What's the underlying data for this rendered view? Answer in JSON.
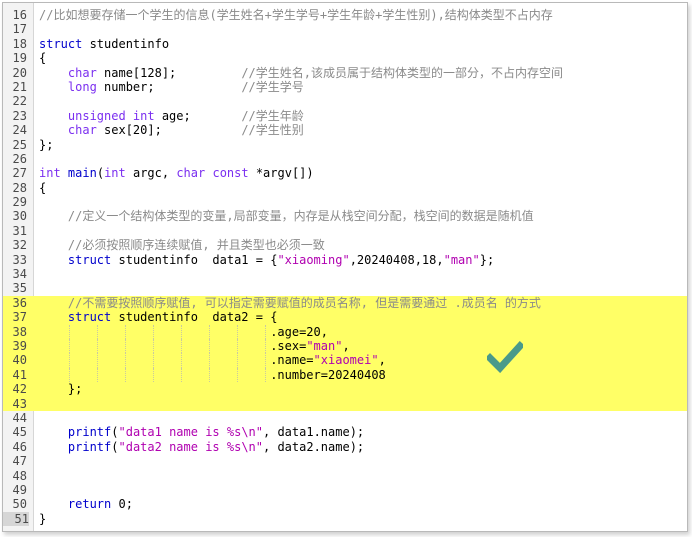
{
  "editor": {
    "highlight_color": "#ffff66",
    "check_color": "#4a9a8a",
    "lines": [
      {
        "n": "16",
        "hl": false,
        "segs": [
          [
            "cm",
            "//比如想要存储一个学生的信息(学生姓名+学生学号+学生年龄+学生性别),结构体类型不占内存"
          ]
        ]
      },
      {
        "n": "17",
        "hl": false,
        "segs": []
      },
      {
        "n": "18",
        "hl": false,
        "segs": [
          [
            "kw",
            "struct"
          ],
          [
            "",
            " studentinfo"
          ]
        ]
      },
      {
        "n": "19",
        "hl": false,
        "segs": [
          [
            "",
            "{"
          ]
        ]
      },
      {
        "n": "20",
        "hl": false,
        "segs": [
          [
            "",
            "    "
          ],
          [
            "ty",
            "char"
          ],
          [
            "",
            " name[128];         "
          ],
          [
            "cm",
            "//学生姓名,该成员属于结构体类型的一部分，不占内存空间"
          ]
        ]
      },
      {
        "n": "21",
        "hl": false,
        "segs": [
          [
            "",
            "    "
          ],
          [
            "ty",
            "long"
          ],
          [
            "",
            " number;            "
          ],
          [
            "cm",
            "//学生学号"
          ]
        ]
      },
      {
        "n": "22",
        "hl": false,
        "segs": []
      },
      {
        "n": "23",
        "hl": false,
        "segs": [
          [
            "",
            "    "
          ],
          [
            "ty",
            "unsigned int"
          ],
          [
            "",
            " age;       "
          ],
          [
            "cm",
            "//学生年龄"
          ]
        ]
      },
      {
        "n": "24",
        "hl": false,
        "segs": [
          [
            "",
            "    "
          ],
          [
            "ty",
            "char"
          ],
          [
            "",
            " sex[20];           "
          ],
          [
            "cm",
            "//学生性别"
          ]
        ]
      },
      {
        "n": "25",
        "hl": false,
        "segs": [
          [
            "",
            "};"
          ]
        ]
      },
      {
        "n": "26",
        "hl": false,
        "segs": []
      },
      {
        "n": "27",
        "hl": false,
        "segs": [
          [
            "ty",
            "int"
          ],
          [
            "",
            " "
          ],
          [
            "kw",
            "main"
          ],
          [
            "",
            "("
          ],
          [
            "ty",
            "int"
          ],
          [
            "",
            " argc, "
          ],
          [
            "ty",
            "char"
          ],
          [
            "",
            " "
          ],
          [
            "ty",
            "const"
          ],
          [
            "",
            " *argv[])"
          ]
        ]
      },
      {
        "n": "28",
        "hl": false,
        "segs": [
          [
            "",
            "{"
          ]
        ]
      },
      {
        "n": "29",
        "hl": false,
        "segs": []
      },
      {
        "n": "30",
        "hl": false,
        "segs": [
          [
            "",
            "    "
          ],
          [
            "cm",
            "//定义一个结构体类型的变量,局部变量，内存是从栈空间分配，栈空间的数据是随机值"
          ]
        ]
      },
      {
        "n": "31",
        "hl": false,
        "segs": []
      },
      {
        "n": "32",
        "hl": false,
        "segs": [
          [
            "",
            "    "
          ],
          [
            "cm",
            "//必须按照顺序连续赋值, 并且类型也必须一致"
          ]
        ]
      },
      {
        "n": "33",
        "hl": false,
        "segs": [
          [
            "",
            "    "
          ],
          [
            "kw",
            "struct"
          ],
          [
            "",
            " studentinfo  data1 = {"
          ],
          [
            "st",
            "\"xiaoming\""
          ],
          [
            "",
            ",20240408,18,"
          ],
          [
            "st",
            "\"man\""
          ],
          [
            "",
            "};"
          ]
        ]
      },
      {
        "n": "34",
        "hl": false,
        "segs": []
      },
      {
        "n": "35",
        "hl": false,
        "segs": []
      },
      {
        "n": "36",
        "hl": true,
        "segs": [
          [
            "",
            "    "
          ],
          [
            "cm",
            "//不需要按照顺序赋值, 可以指定需要赋值的成员名称, 但是需要通过 .成员名 的方式"
          ]
        ]
      },
      {
        "n": "37",
        "hl": true,
        "segs": [
          [
            "",
            "    "
          ],
          [
            "kw",
            "struct"
          ],
          [
            "",
            " studentinfo  data2 = {"
          ]
        ]
      },
      {
        "n": "38",
        "hl": true,
        "segs": [
          [
            "",
            "                                .age=20,"
          ]
        ]
      },
      {
        "n": "39",
        "hl": true,
        "segs": [
          [
            "",
            "                                .sex="
          ],
          [
            "st",
            "\"man\""
          ],
          [
            "",
            ","
          ]
        ]
      },
      {
        "n": "40",
        "hl": true,
        "segs": [
          [
            "",
            "                                .name="
          ],
          [
            "st",
            "\"xiaomei\""
          ],
          [
            "",
            ","
          ]
        ]
      },
      {
        "n": "41",
        "hl": true,
        "segs": [
          [
            "",
            "                                .number=20240408"
          ]
        ]
      },
      {
        "n": "42",
        "hl": true,
        "segs": [
          [
            "",
            "    };"
          ]
        ]
      },
      {
        "n": "43",
        "hl": true,
        "segs": []
      },
      {
        "n": "44",
        "hl": false,
        "segs": []
      },
      {
        "n": "45",
        "hl": false,
        "segs": [
          [
            "",
            "    "
          ],
          [
            "kw",
            "printf"
          ],
          [
            "",
            "("
          ],
          [
            "st",
            "\"data1 name is %s\\n\""
          ],
          [
            "",
            ", data1.name);"
          ]
        ]
      },
      {
        "n": "46",
        "hl": false,
        "segs": [
          [
            "",
            "    "
          ],
          [
            "kw",
            "printf"
          ],
          [
            "",
            "("
          ],
          [
            "st",
            "\"data2 name is %s\\n\""
          ],
          [
            "",
            ", data2.name);"
          ]
        ]
      },
      {
        "n": "47",
        "hl": false,
        "segs": []
      },
      {
        "n": "48",
        "hl": false,
        "segs": []
      },
      {
        "n": "49",
        "hl": false,
        "segs": []
      },
      {
        "n": "50",
        "hl": false,
        "segs": [
          [
            "",
            "    "
          ],
          [
            "kw",
            "return"
          ],
          [
            "",
            " 0;"
          ]
        ]
      },
      {
        "n": "51",
        "hl": false,
        "last": true,
        "segs": [
          [
            "",
            "}"
          ]
        ]
      }
    ]
  }
}
